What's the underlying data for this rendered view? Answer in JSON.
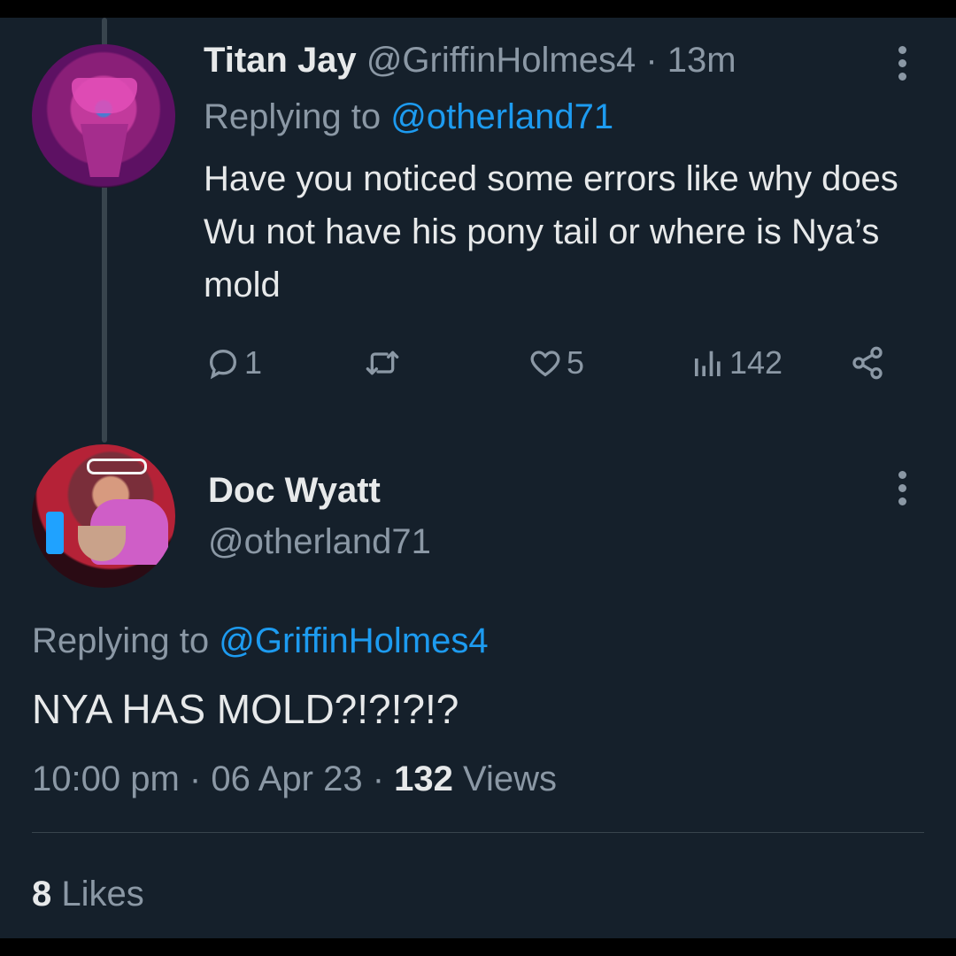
{
  "tweet1": {
    "display_name": "Titan Jay",
    "handle": "@GriffinHolmes4",
    "separator": " · ",
    "time": "13m",
    "replying_prefix": "Replying to ",
    "replying_to": "@otherland71",
    "body": "Have you noticed some errors like why does Wu not have his pony tail or where is Nya’s mold",
    "actions": {
      "reply_count": "1",
      "retweet_count": "",
      "like_count": "5",
      "view_count": "142"
    },
    "icons": [
      "reply-icon",
      "retweet-icon",
      "like-icon",
      "views-icon",
      "share-icon",
      "more-icon"
    ]
  },
  "tweet2": {
    "display_name": "Doc Wyatt",
    "handle": "@otherland71",
    "replying_prefix": "Replying to ",
    "replying_to": "@GriffinHolmes4",
    "body": "NYA HAS MOLD?!?!?!?",
    "time": "10:00 pm",
    "dot1": " · ",
    "date": "06 Apr 23",
    "dot2": " · ",
    "views_count": "132",
    "views_label": " Views",
    "likes_count": "8",
    "likes_label": " Likes"
  },
  "colors": {
    "background": "#15202b",
    "link": "#1d9bf0",
    "muted": "#8b98a5",
    "text": "#e7e9ea"
  }
}
